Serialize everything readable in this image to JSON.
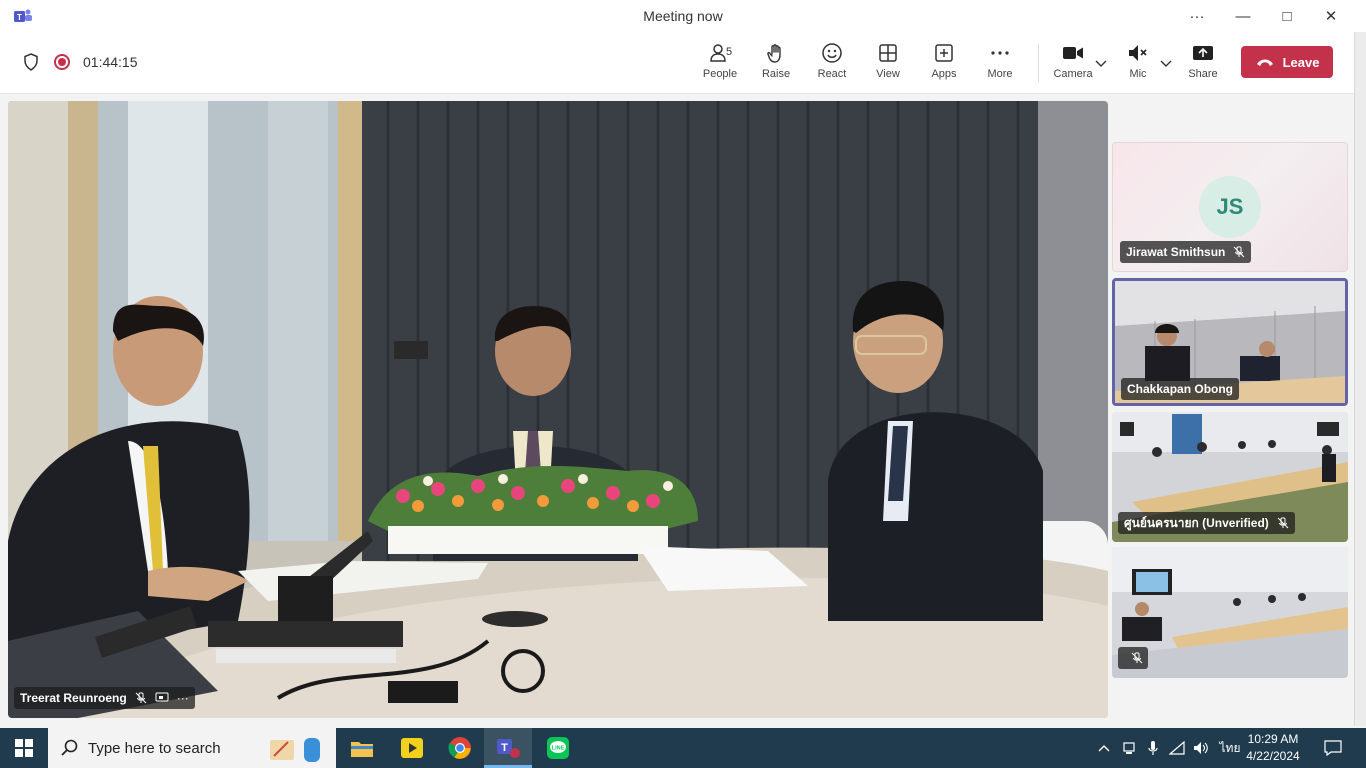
{
  "window": {
    "title": "Meeting now",
    "controls": {
      "more": "···",
      "minimize": "—",
      "maximize": "□",
      "close": "✕"
    }
  },
  "toolbar": {
    "timer": "01:44:15",
    "people_count": "5",
    "buttons": {
      "people": "People",
      "raise": "Raise",
      "react": "React",
      "view": "View",
      "apps": "Apps",
      "more": "More",
      "camera": "Camera",
      "mic": "Mic",
      "share": "Share",
      "leave": "Leave"
    }
  },
  "main_stage": {
    "participant_name": "Treerat Reunroeng"
  },
  "tiles": [
    {
      "name": "Jirawat Smithsun",
      "initials": "JS",
      "muted": true
    },
    {
      "name": "Chakkapan Obong",
      "muted": false,
      "active": true
    },
    {
      "name": "ศูนย์นครนายก (Unverified)",
      "muted": true
    },
    {
      "name": "",
      "muted": true
    }
  ],
  "taskbar": {
    "search_placeholder": "Type here to search",
    "apps": [
      "notes",
      "edge-like",
      "file-explorer",
      "player",
      "chrome",
      "teams",
      "line"
    ],
    "language": "ไทย",
    "time": "10:29 AM",
    "date": "4/22/2024"
  },
  "colors": {
    "leave": "#c4314b",
    "accent": "#6264a7",
    "taskbar": "#1f3b4d"
  }
}
